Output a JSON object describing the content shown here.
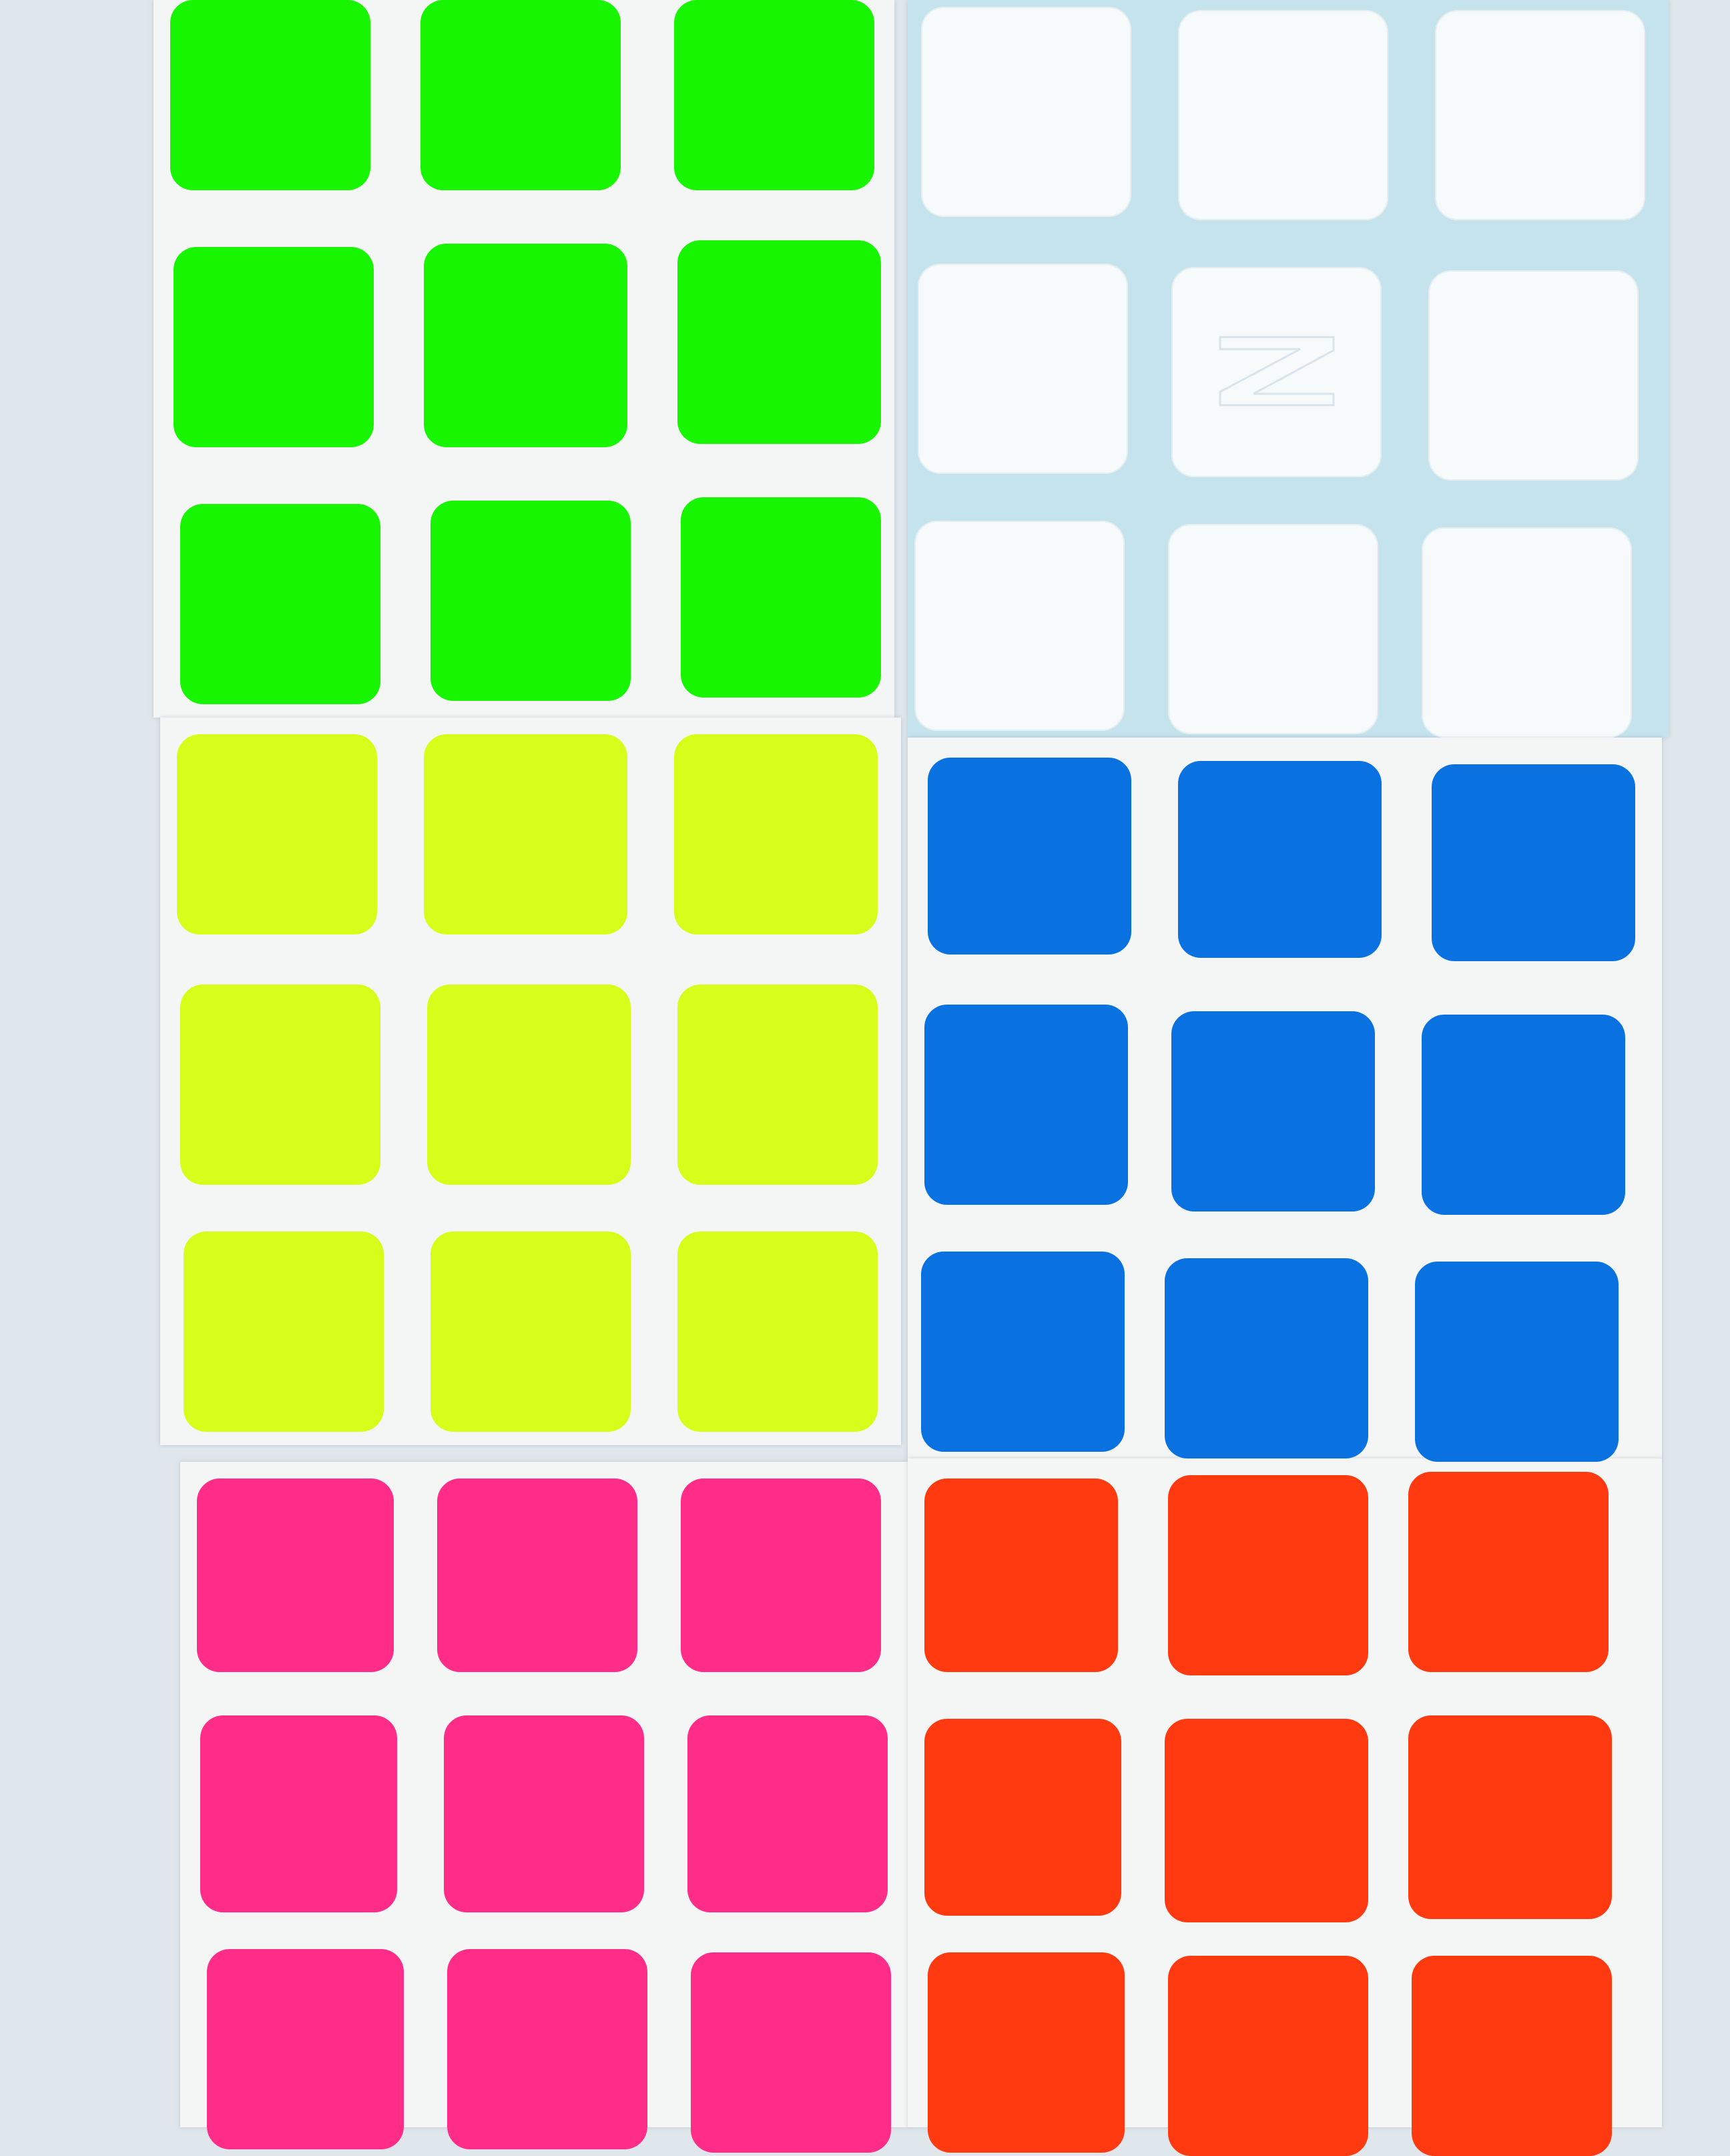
{
  "sheets": [
    {
      "id": "green",
      "colors": {
        "sticker": "#18f500",
        "sheet": "white"
      },
      "logo": false
    },
    {
      "id": "white",
      "colors": {
        "sticker": "#f7fafb",
        "sheet": "backing"
      },
      "logo": true,
      "logo_icon": "z-logo-embossed-icon"
    },
    {
      "id": "yellow",
      "colors": {
        "sticker": "#d5fe1a",
        "sheet": "white"
      },
      "logo": false
    },
    {
      "id": "blue",
      "colors": {
        "sticker": "#0a72e0",
        "sheet": "white"
      },
      "logo": false
    },
    {
      "id": "pink",
      "colors": {
        "sticker": "#ff2d88",
        "sheet": "white"
      },
      "logo": false
    },
    {
      "id": "orange",
      "colors": {
        "sticker": "#ff3a10",
        "sheet": "white"
      },
      "logo": false
    }
  ]
}
